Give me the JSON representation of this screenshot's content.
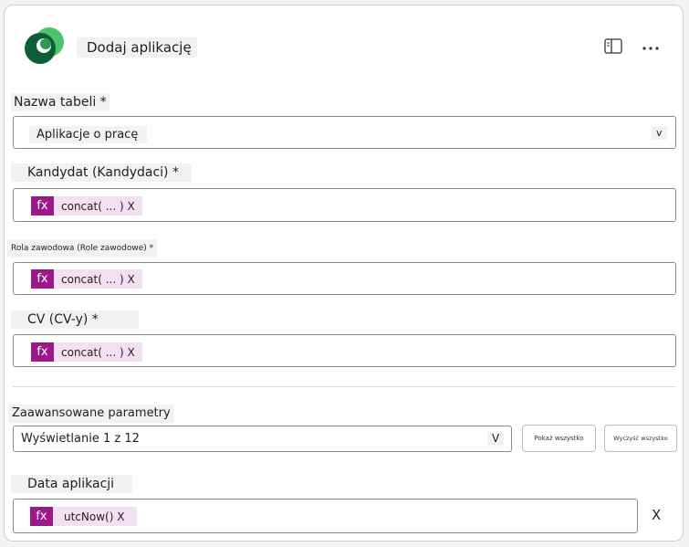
{
  "header": {
    "title": "Dodaj aplikację",
    "logo_colors": {
      "dark": "#0b5e35",
      "light": "#4fc36b"
    }
  },
  "table_field": {
    "label": "Nazwa tabeli *",
    "value": "Aplikacje o pracę",
    "chevron": "v"
  },
  "fields": [
    {
      "label": "Kandydat (Kandydaci) *",
      "fx": "fx",
      "expr": "concat( ... ) X"
    },
    {
      "label": "Rola zawodowa (Role zawodowe) *",
      "fx": "fx",
      "expr": "concat( ... ) X"
    },
    {
      "label": "CV (CV-y) *",
      "fx": "fx",
      "expr": "concat( ... ) X"
    }
  ],
  "advanced": {
    "label": "Zaawansowane parametry",
    "value": "Wyświetlanie 1 z 12",
    "chevron": "V",
    "show_all": "Pokaż wszystko",
    "clear_all": "Wyczyść wszystko"
  },
  "date_field": {
    "label": "Data aplikacji",
    "fx": "fx",
    "expr": "utcNow() X",
    "remove": "X"
  },
  "colors": {
    "fx_bg": "#9b1a8a",
    "chip_bg": "#f5dff2"
  }
}
